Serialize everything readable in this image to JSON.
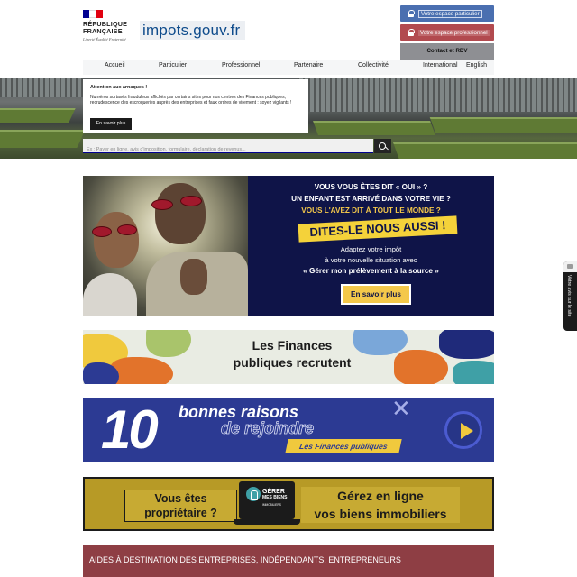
{
  "header": {
    "republic_name": "RÉPUBLIQUE FRANÇAISE",
    "motto": "Liberté Égalité Fraternité",
    "brand": "impots.gouv.fr",
    "buttons": {
      "particulier": "Votre espace particulier",
      "professionnel": "Votre espace professionnel",
      "contact": "Contact et RDV"
    },
    "nav": [
      "Accueil",
      "Particulier",
      "Professionnel",
      "Partenaire",
      "Collectivité",
      "International",
      "English"
    ]
  },
  "alert": {
    "title": "Attention aux arnaques !",
    "text": "Numéros surtaxés frauduleux affichés par certains sites pour nos centres des Finances publiques, recrudescence des escroqueries auprès des entreprises et faux ordres de virement : soyez vigilants !",
    "button": "En savoir plus"
  },
  "search": {
    "placeholder": "Ex : Payer en ligne, avis d'imposition, formulaire, déclaration de revenus..."
  },
  "banner_prelevement": {
    "line1": "VOUS VOUS ÊTES DIT « OUI » ?",
    "line2": "UN ENFANT EST ARRIVÉ DANS VOTRE VIE ?",
    "line3": "VOUS L'AVEZ DIT À TOUT LE MONDE ?",
    "headline": "DITES-LE NOUS AUSSI !",
    "line4": "Adaptez votre impôt",
    "line5": "à votre nouvelle situation avec",
    "line6": "« Gérer mon prélèvement à la source »",
    "button": "En savoir plus"
  },
  "banner_recrutent": {
    "line1": "Les Finances",
    "line2": "publiques recrutent"
  },
  "banner_raisons": {
    "number": "10",
    "line1": "bonnes raisons",
    "line2": "de rejoindre",
    "pill": "Les Finances publiques"
  },
  "banner_biens": {
    "left_line1": "Vous êtes",
    "left_line2": "propriétaire ?",
    "logo_line1": "GÉRER",
    "logo_line2": "MES BIENS",
    "logo_sub": "IMMOBILIERS",
    "right_line1": "Gérez en ligne",
    "right_line2": "vos biens immobiliers"
  },
  "section": {
    "title": "AIDES À DESTINATION DES ENTREPRISES, INDÉPENDANTS, ENTREPRENEURS"
  },
  "side_tab": {
    "label": "Votre avis sur le site"
  },
  "colors": {
    "flag_blue": "#000091",
    "flag_white": "#ffffff",
    "flag_red": "#e1000f",
    "particulier_blue": "#4a6fb0",
    "professionnel_red": "#b24a4f",
    "section_bar": "#8e3e44",
    "banner_navy": "#0f1448",
    "banner_blue": "#2c3a93",
    "accent_yellow": "#f4c84a"
  }
}
